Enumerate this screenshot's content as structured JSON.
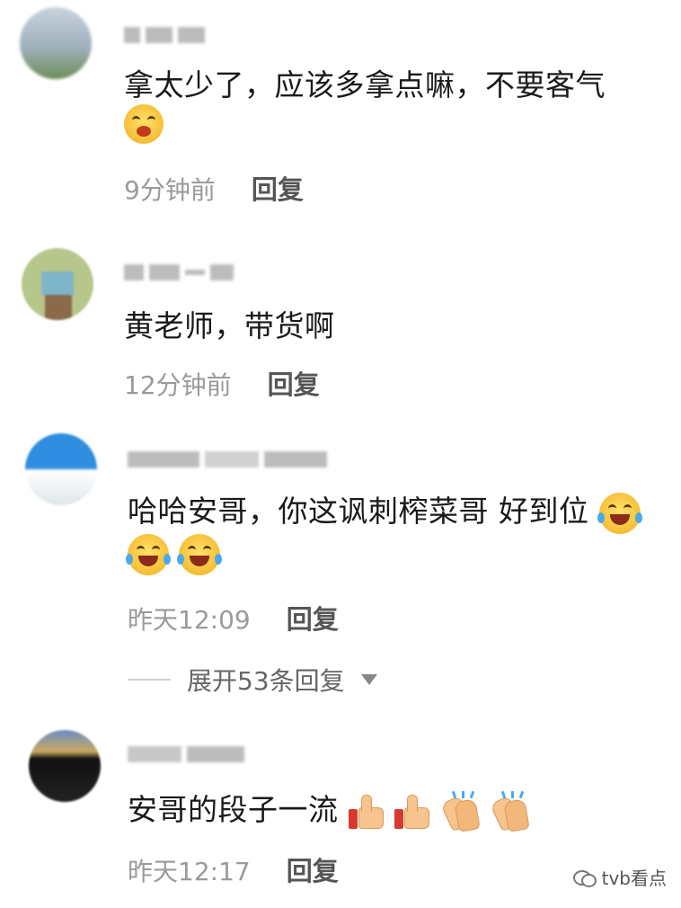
{
  "comments": [
    {
      "text": "拿太少了，应该多拿点嘛，不要客气",
      "time": "9分钟前",
      "reply": "回复"
    },
    {
      "text": "黄老师，带货啊",
      "time": "12分钟前",
      "reply": "回复"
    },
    {
      "text": "哈哈安哥，你这讽刺榨菜哥 好到位",
      "time": "昨天12:09",
      "reply": "回复",
      "expand": "展开53条回复"
    },
    {
      "text": "安哥的段子一流",
      "time": "昨天12:17",
      "reply": "回复"
    }
  ],
  "watermark": "tvb看点",
  "icons": {
    "laugh_cry": "face-with-tears-of-joy-icon",
    "thumbs_up": "thumbs-up-icon",
    "clap": "clapping-hands-icon",
    "chevron": "triangle-down-icon",
    "wechat": "wechat-icon"
  }
}
